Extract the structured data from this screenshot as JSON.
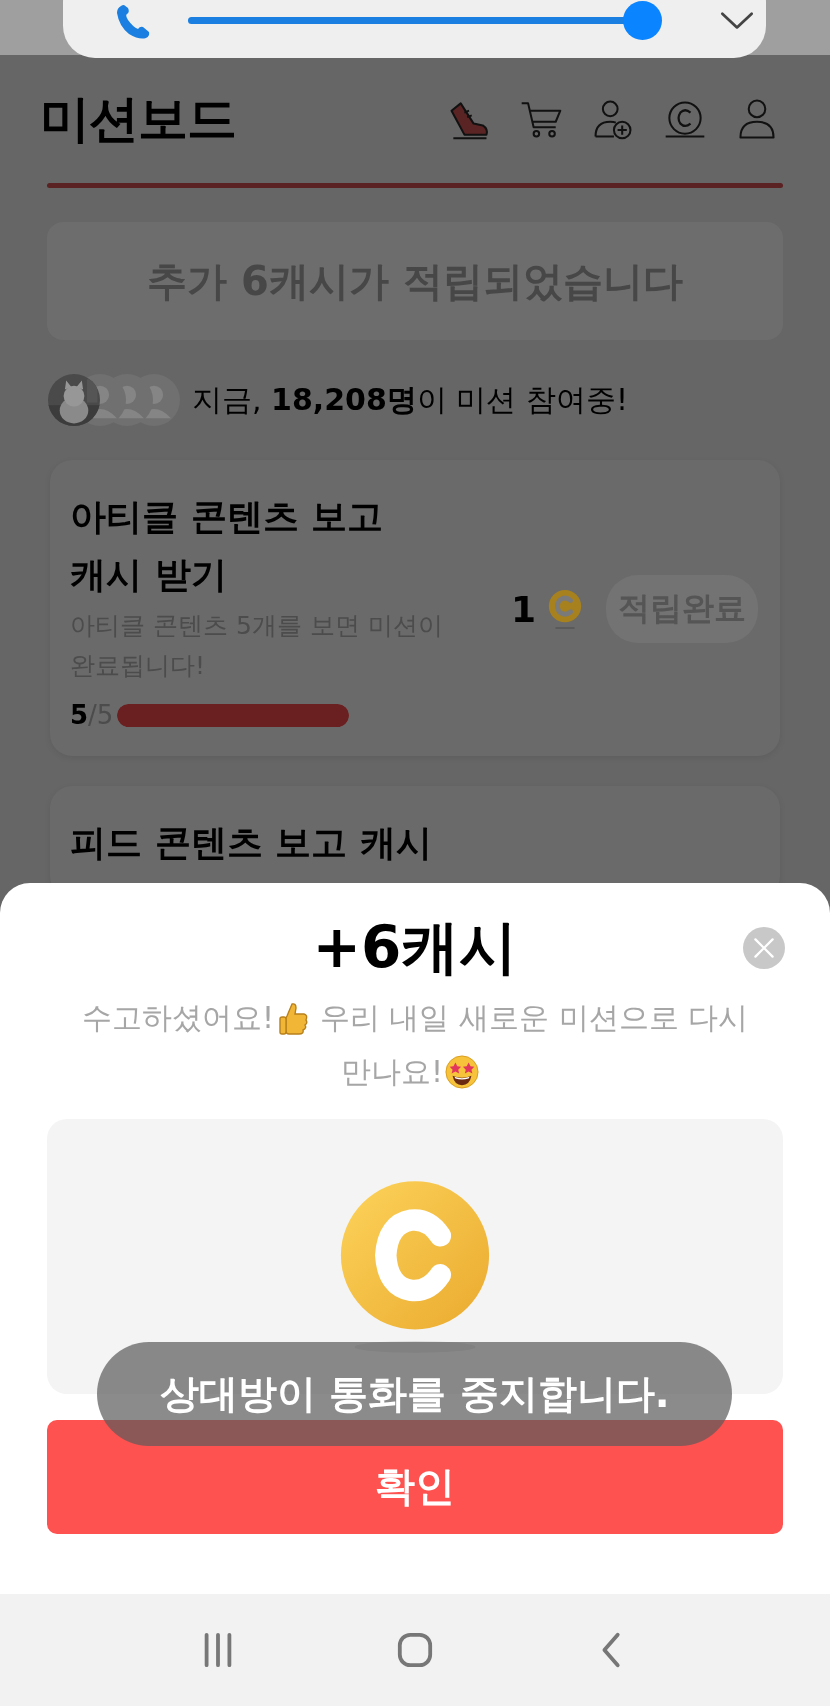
{
  "call_panel": {
    "slider": {
      "level": 1
    }
  },
  "header": {
    "title": "미션보드"
  },
  "banner": {
    "text": "추가 6캐시가 적립되었습니다"
  },
  "participants": {
    "text": "지금, **18,208명**이 미션 참여중!"
  },
  "missions": [
    {
      "title": "아티클 콘텐츠 보고 캐시 받기",
      "description": "아티클 콘텐츠 5개를 보면 미션이 완료됩니다!",
      "progress": "**5**/5",
      "level": 1,
      "reward": "1",
      "status": "적립완료"
    },
    {
      "title": "피드 콘텐츠 보고 캐시"
    }
  ],
  "sheet": {
    "title": "+6캐시",
    "message_start": "수고하셨어요!",
    "message_middle": "우리 내일 새로운 미션으로 다시",
    "message_end": "만나요!",
    "button": "확인"
  },
  "toast": {
    "text": "상대방이 통화를 중지합니다."
  }
}
